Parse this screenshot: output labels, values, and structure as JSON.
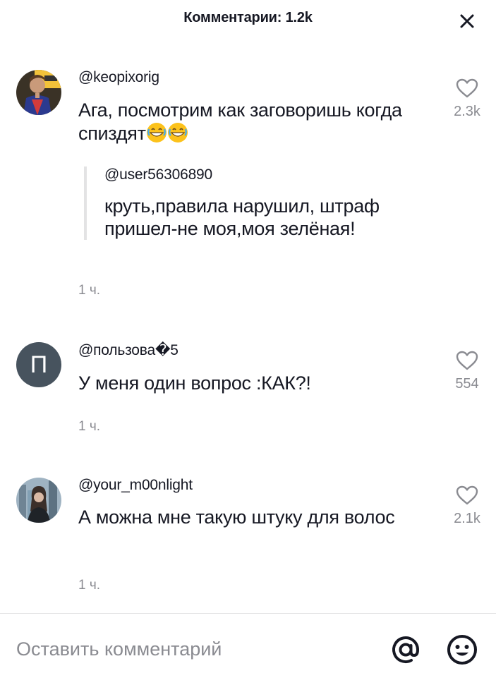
{
  "header": {
    "title": "Комментарии: 1.2k",
    "close_icon": "close-icon"
  },
  "comments": [
    {
      "username": "@keopixorig",
      "text": "Ага, посмотрим как заговоришь когда спиздят",
      "emojis": [
        "grinning-sweat-emoji",
        "grinning-sweat-emoji"
      ],
      "likes": "2.3k",
      "time": "1 ч.",
      "quote": {
        "username": "@user56306890",
        "text": "круть,правила нарушил, штраф пришел-не моя,моя зелёная!"
      }
    },
    {
      "username": "@пользова�5",
      "avatar_letter": "П",
      "text": "У меня один вопрос :КАК?!",
      "likes": "554",
      "time": "1 ч."
    },
    {
      "username": "@your_m00nlight",
      "text": "А можна мне такую штуку для волос",
      "likes": "2.1k",
      "time": "1 ч."
    }
  ],
  "input": {
    "placeholder": "Оставить комментарий",
    "mention_icon": "at-icon",
    "emoji_icon": "emoji-icon"
  },
  "colors": {
    "text": "#161823",
    "secondary": "#8a8b91",
    "divider": "#e3e3e4",
    "avatar_bg": "#47535e"
  }
}
